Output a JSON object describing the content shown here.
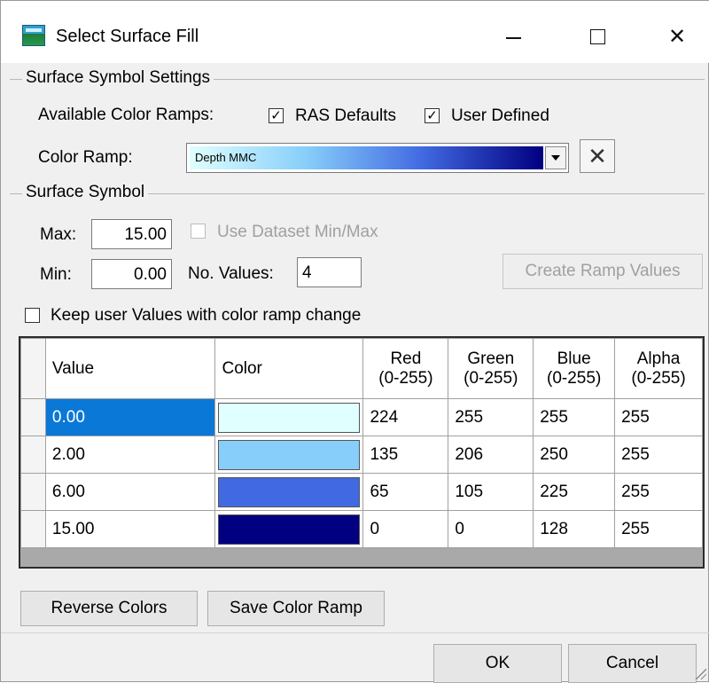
{
  "window": {
    "title": "Select Surface Fill"
  },
  "settings": {
    "group_label": "Surface Symbol Settings",
    "available_label": "Available Color Ramps:",
    "ras_defaults": {
      "label": "RAS Defaults",
      "checked": true
    },
    "user_defined": {
      "label": "User Defined",
      "checked": true
    },
    "color_ramp_label": "Color Ramp:",
    "color_ramp_value": "Depth MMC"
  },
  "symbol": {
    "group_label": "Surface Symbol",
    "max_label": "Max:",
    "max_value": "15.00",
    "use_dataset_label": "Use Dataset Min/Max",
    "min_label": "Min:",
    "min_value": "0.00",
    "no_values_label": "No. Values:",
    "no_values_value": "4",
    "create_ramp_label": "Create Ramp Values",
    "keep_user_label": "Keep user Values with color ramp change"
  },
  "table": {
    "headers": {
      "value": "Value",
      "color": "Color",
      "red": [
        "Red",
        "(0-255)"
      ],
      "green": [
        "Green",
        "(0-255)"
      ],
      "blue": [
        "Blue",
        "(0-255)"
      ],
      "alpha": [
        "Alpha",
        "(0-255)"
      ]
    },
    "rows": [
      {
        "value": "0.00",
        "color": "#e0ffff",
        "red": "224",
        "green": "255",
        "blue": "255",
        "alpha": "255"
      },
      {
        "value": "2.00",
        "color": "#87cefa",
        "red": "135",
        "green": "206",
        "blue": "250",
        "alpha": "255"
      },
      {
        "value": "6.00",
        "color": "#4169e1",
        "red": "65",
        "green": "105",
        "blue": "225",
        "alpha": "255"
      },
      {
        "value": "15.00",
        "color": "#000080",
        "red": "0",
        "green": "0",
        "blue": "128",
        "alpha": "255"
      }
    ]
  },
  "buttons": {
    "reverse": "Reverse Colors",
    "save_ramp": "Save Color Ramp",
    "ok": "OK",
    "cancel": "Cancel"
  },
  "colors": {
    "selection": "#0a78d7"
  }
}
